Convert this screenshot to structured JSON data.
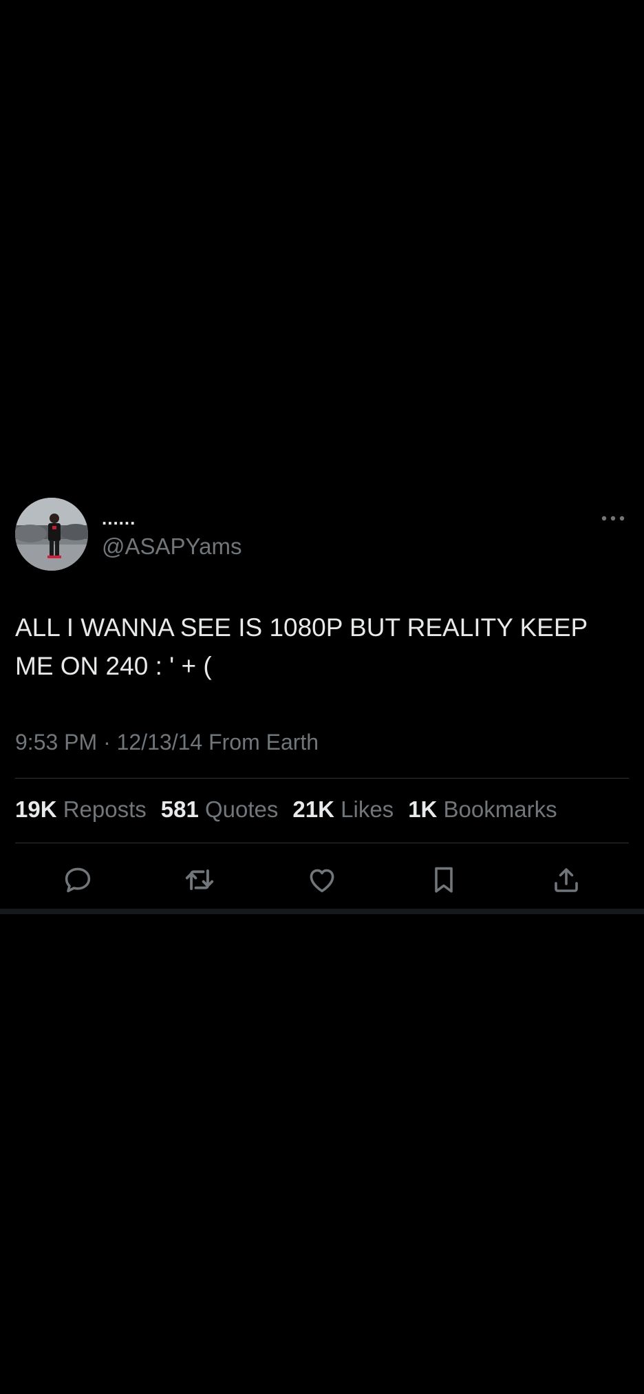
{
  "tweet": {
    "display_name": "......",
    "handle": "@ASAPYams",
    "text": "ALL I WANNA SEE IS 1080P BUT REALITY KEEP ME ON 240 : ' + (",
    "time": "9:53 PM",
    "separator": "·",
    "date": "12/13/14",
    "source": "From Earth",
    "more_icon": "more-horizontal-icon"
  },
  "stats": [
    {
      "count": "19K",
      "label": "Reposts"
    },
    {
      "count": "581",
      "label": "Quotes"
    },
    {
      "count": "21K",
      "label": "Likes"
    },
    {
      "count": "1K",
      "label": "Bookmarks"
    }
  ],
  "actions": [
    {
      "icon": "reply-icon"
    },
    {
      "icon": "repost-icon"
    },
    {
      "icon": "like-icon"
    },
    {
      "icon": "bookmark-icon"
    },
    {
      "icon": "share-icon"
    }
  ],
  "colors": {
    "background": "#000000",
    "primary_text": "#e7e9ea",
    "secondary_text": "#71767b",
    "divider": "#2f3336"
  }
}
